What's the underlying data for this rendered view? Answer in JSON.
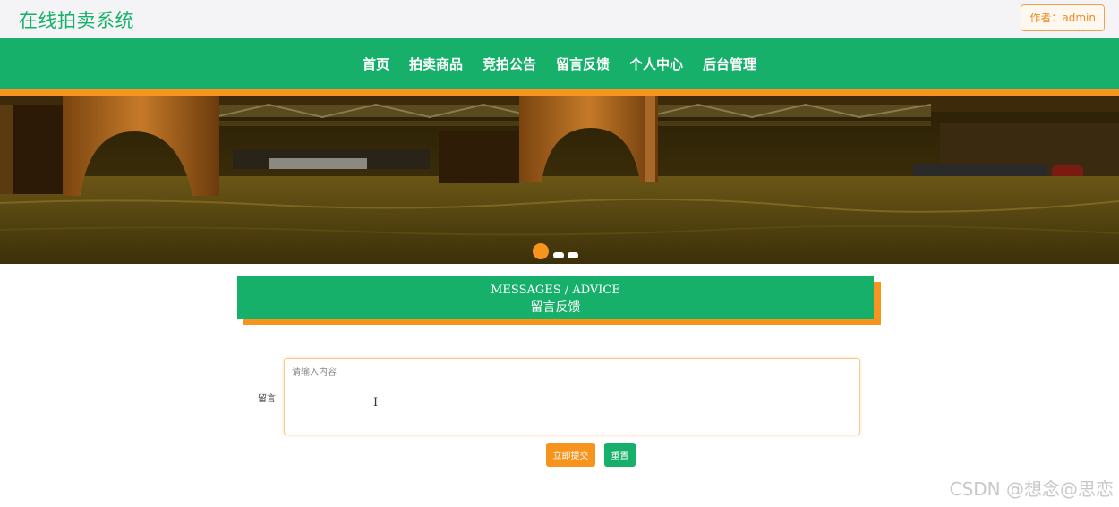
{
  "header": {
    "site_title": "在线拍卖系统",
    "author_badge": "作者：admin"
  },
  "nav": {
    "items": [
      "首页",
      "拍卖商品",
      "竞拍公告",
      "留言反馈",
      "个人中心",
      "后台管理"
    ]
  },
  "banner": {
    "slides_count": 3,
    "active_slide": 1
  },
  "section": {
    "title_en": "MESSAGES / ADVICE",
    "title_cn": "留言反馈"
  },
  "form": {
    "label": "留言",
    "placeholder": "请输入内容",
    "value": "",
    "submit_label": "立即提交",
    "reset_label": "重置"
  },
  "watermark": "CSDN @想念@思恋",
  "colors": {
    "brand_green": "#16b06a",
    "accent_orange": "#f7941d"
  }
}
